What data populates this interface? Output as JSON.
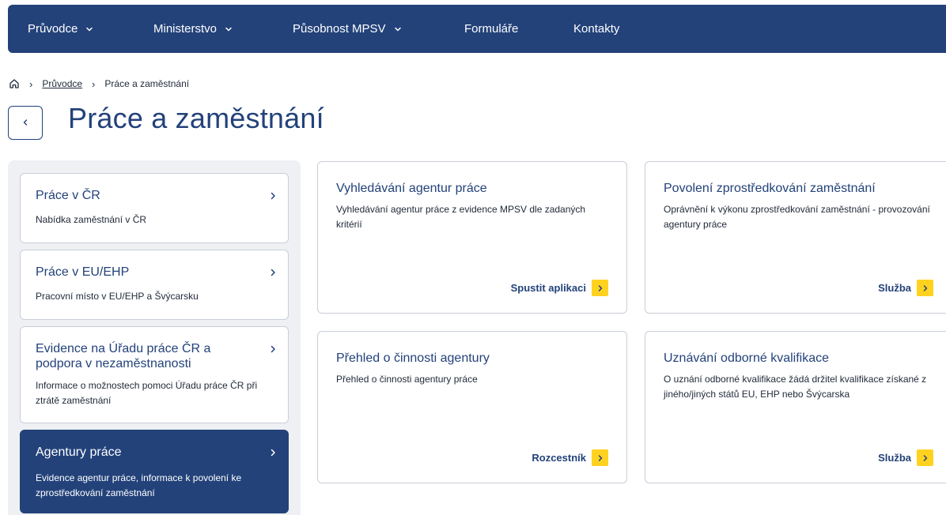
{
  "topnav": {
    "items": [
      {
        "label": "Průvodce",
        "has_dropdown": true
      },
      {
        "label": "Ministerstvo",
        "has_dropdown": true
      },
      {
        "label": "Působnost MPSV",
        "has_dropdown": true
      },
      {
        "label": "Formuláře",
        "has_dropdown": false
      },
      {
        "label": "Kontakty",
        "has_dropdown": false
      }
    ]
  },
  "breadcrumb": {
    "home_icon": "home-icon",
    "items": [
      {
        "label": "Průvodce",
        "link": true
      },
      {
        "label": "Práce a zaměstnání",
        "link": false
      }
    ]
  },
  "page": {
    "back_icon": "chevron-left-icon",
    "title": "Práce a zaměstnání"
  },
  "sidebar": {
    "items": [
      {
        "title": "Práce v ČR",
        "description": "Nabídka zaměstnání v ČR",
        "active": false
      },
      {
        "title": "Práce v EU/EHP",
        "description": "Pracovní místo v EU/EHP a Švýcarsku",
        "active": false
      },
      {
        "title": "Evidence na Úřadu práce ČR a podpora v nezaměstnanosti",
        "description": "Informace o možnostech pomoci Úřadu práce ČR při ztrátě zaměstnání",
        "active": false
      },
      {
        "title": "Agentury práce",
        "description": "Evidence agentur práce, informace k povolení ke zprostředkování zaměstnání",
        "active": true
      }
    ]
  },
  "cards": [
    {
      "title": "Vyhledávání agentur práce",
      "description": "Vyhledávání agentur práce z evidence MPSV dle zadaných kritérií",
      "action": "Spustit aplikaci"
    },
    {
      "title": "Povolení zprostředkování zaměstnání",
      "description": "Oprávnění k výkonu zprostředkování zaměstnání - provozování agentury práce",
      "action": "Služba"
    },
    {
      "title": "Přehled o činnosti agentury",
      "description": "Přehled o činnosti agentury práce",
      "action": "Rozcestník"
    },
    {
      "title": "Uznávání odborné kvalifikace",
      "description": "O uznání odborné kvalifikace žádá držitel kvalifikace získané z jiného/jiných států EU, EHP nebo Švýcarska",
      "action": "Služba"
    }
  ],
  "colors": {
    "brand_navy": "#23427a",
    "accent_yellow": "#ffd21f",
    "panel_bg": "#eef0f3",
    "border": "#c9ced8"
  }
}
